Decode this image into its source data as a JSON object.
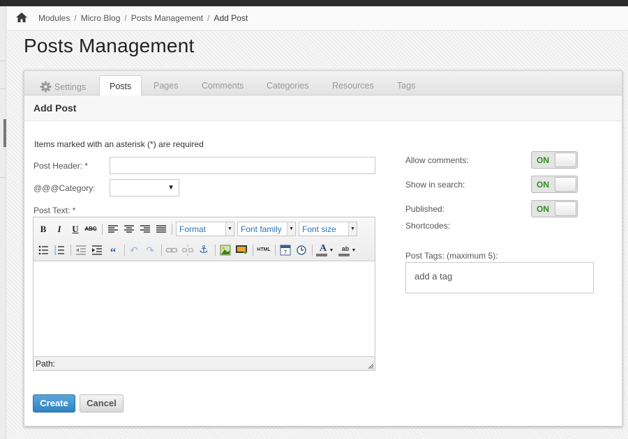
{
  "breadcrumb": {
    "items": [
      "Modules",
      "Micro Blog",
      "Posts Management",
      "Add Post"
    ],
    "separator": "/"
  },
  "page_title": "Posts Management",
  "tabs": [
    {
      "label": "Settings",
      "icon": "gear-icon"
    },
    {
      "label": "Posts",
      "active": true
    },
    {
      "label": "Pages"
    },
    {
      "label": "Comments"
    },
    {
      "label": "Categories"
    },
    {
      "label": "Resources"
    },
    {
      "label": "Tags"
    }
  ],
  "section_title": "Add Post",
  "form": {
    "required_note": "Items marked with an asterisk (*) are required",
    "post_header_label": "Post Header: *",
    "post_header_value": "",
    "category_label": "@@@Category:",
    "category_value": "",
    "post_text_label": "Post Text: *",
    "editor": {
      "format_label": "Format",
      "font_family_label": "Font family",
      "font_size_label": "Font size",
      "path_label": "Path:",
      "buttons": [
        "bold-icon",
        "italic-icon",
        "underline-icon",
        "strikethrough-icon",
        "align-left-icon",
        "align-center-icon",
        "align-right-icon",
        "align-justify-icon",
        "bullet-list-icon",
        "numbered-list-icon",
        "outdent-icon",
        "indent-icon",
        "blockquote-icon",
        "undo-icon",
        "redo-icon",
        "link-icon",
        "unlink-icon",
        "anchor-icon",
        "image-icon",
        "insert-media-icon",
        "html-icon",
        "insert-date-icon",
        "insert-time-icon",
        "text-color-icon",
        "highlight-color-icon"
      ]
    }
  },
  "side": {
    "allow_comments_label": "Allow comments:",
    "allow_comments_state": "ON",
    "show_in_search_label": "Show in search:",
    "show_in_search_state": "ON",
    "published_label": "Published:",
    "published_state": "ON",
    "shortcodes_label": "Shortcodes:",
    "post_tags_label": "Post Tags: (maximum 5):",
    "tags_placeholder": "add a tag"
  },
  "actions": {
    "create_label": "Create",
    "cancel_label": "Cancel"
  },
  "colors": {
    "toggle_on_text": "#2e8f1a",
    "create_button": "#3a8fcd",
    "dropdown_text": "#2a75b5"
  }
}
